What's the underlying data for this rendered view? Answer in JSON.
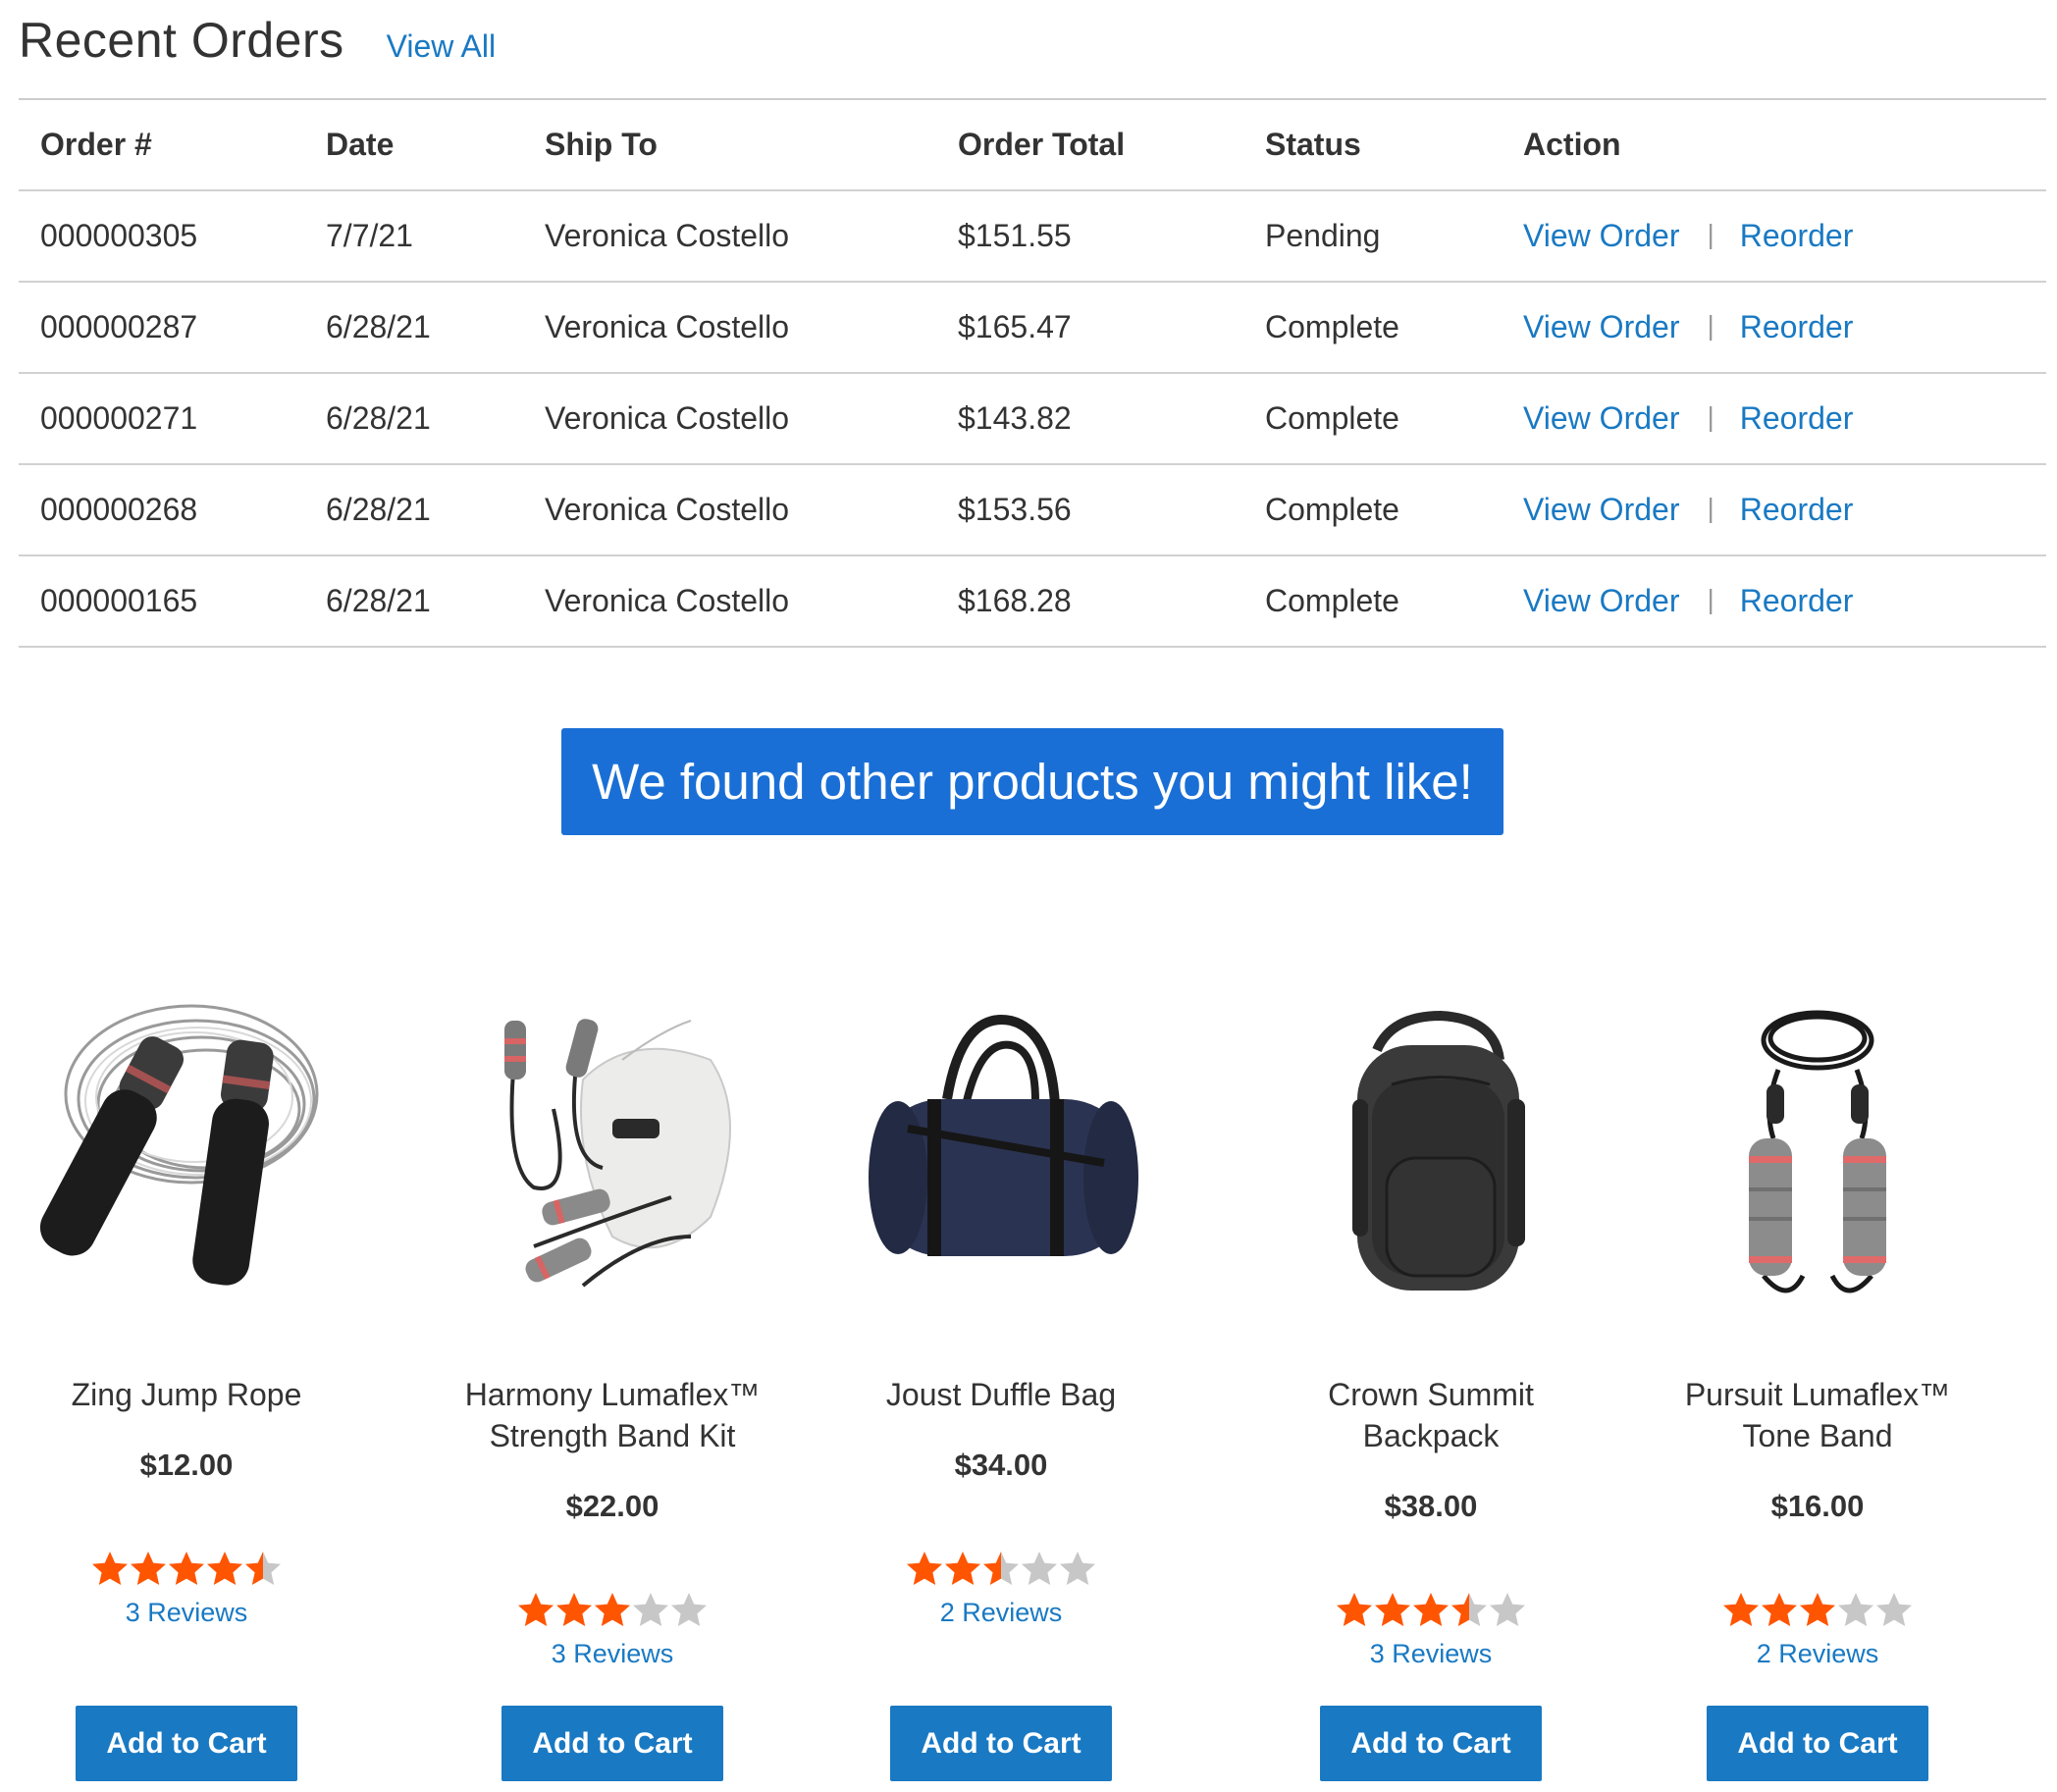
{
  "header": {
    "title": "Recent Orders",
    "view_all": "View All"
  },
  "table": {
    "columns": [
      "Order #",
      "Date",
      "Ship To",
      "Order Total",
      "Status",
      "Action"
    ],
    "rows": [
      {
        "order": "000000305",
        "date": "7/7/21",
        "ship_to": "Veronica Costello",
        "total": "$151.55",
        "status": "Pending",
        "view": "View Order",
        "reorder": "Reorder"
      },
      {
        "order": "000000287",
        "date": "6/28/21",
        "ship_to": "Veronica Costello",
        "total": "$165.47",
        "status": "Complete",
        "view": "View Order",
        "reorder": "Reorder"
      },
      {
        "order": "000000271",
        "date": "6/28/21",
        "ship_to": "Veronica Costello",
        "total": "$143.82",
        "status": "Complete",
        "view": "View Order",
        "reorder": "Reorder"
      },
      {
        "order": "000000268",
        "date": "6/28/21",
        "ship_to": "Veronica Costello",
        "total": "$153.56",
        "status": "Complete",
        "view": "View Order",
        "reorder": "Reorder"
      },
      {
        "order": "000000165",
        "date": "6/28/21",
        "ship_to": "Veronica Costello",
        "total": "$168.28",
        "status": "Complete",
        "view": "View Order",
        "reorder": "Reorder"
      }
    ]
  },
  "banner": {
    "text": "We found other products you might like!"
  },
  "products": [
    {
      "name": "Zing Jump Rope",
      "price": "$12.00",
      "rating": 4.5,
      "reviews": "3  Reviews",
      "button": "Add to Cart",
      "image_icon": "jump-rope-icon"
    },
    {
      "name": "Harmony Lumaflex™\nStrength Band Kit",
      "price": "$22.00",
      "rating": 3,
      "reviews": "3  Reviews",
      "button": "Add to Cart",
      "image_icon": "strength-band-kit-icon"
    },
    {
      "name": "Joust Duffle Bag",
      "price": "$34.00",
      "rating": 2.5,
      "reviews": "2  Reviews",
      "button": "Add to Cart",
      "image_icon": "duffle-bag-icon"
    },
    {
      "name": "Crown Summit\nBackpack",
      "price": "$38.00",
      "rating": 3.5,
      "reviews": "3  Reviews",
      "button": "Add to Cart",
      "image_icon": "backpack-icon"
    },
    {
      "name": "Pursuit Lumaflex™\nTone Band",
      "price": "$16.00",
      "rating": 3,
      "reviews": "2  Reviews",
      "button": "Add to Cart",
      "image_icon": "tone-band-icon"
    }
  ],
  "colors": {
    "link": "#1979c3",
    "banner": "#1a6fd6",
    "button": "#1979c3",
    "star_filled": "#ff5501",
    "star_empty": "#c7c7c7"
  }
}
